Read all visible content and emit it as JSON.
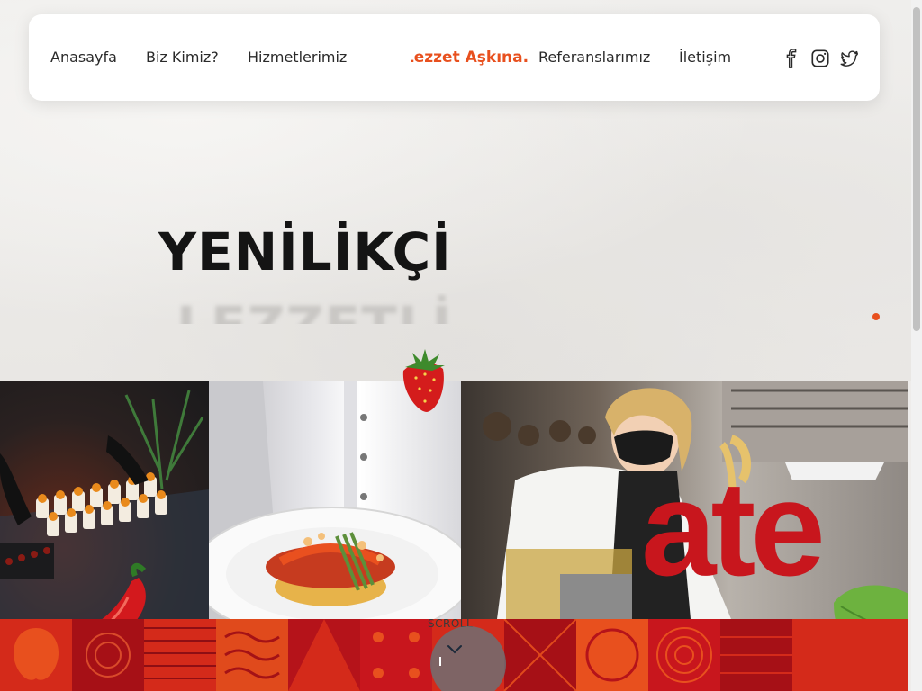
{
  "nav": {
    "links": [
      "Anasayfa",
      "Biz Kimiz?",
      "Hizmetlerimiz",
      "Referanslarımız",
      "İletişim"
    ],
    "brand": "Lezzet Aşkına.",
    "social": [
      "facebook-icon",
      "instagram-icon",
      "twitter-icon"
    ]
  },
  "hero": {
    "title": "YENİLİKÇİ",
    "subtitle": "LEZZETLİ"
  },
  "scroll": {
    "label": "SCROLL"
  },
  "logo": {
    "text": "ate"
  },
  "colors": {
    "accent": "#e8501e",
    "brand_red": "#c8161d",
    "text": "#2a2a2a"
  }
}
